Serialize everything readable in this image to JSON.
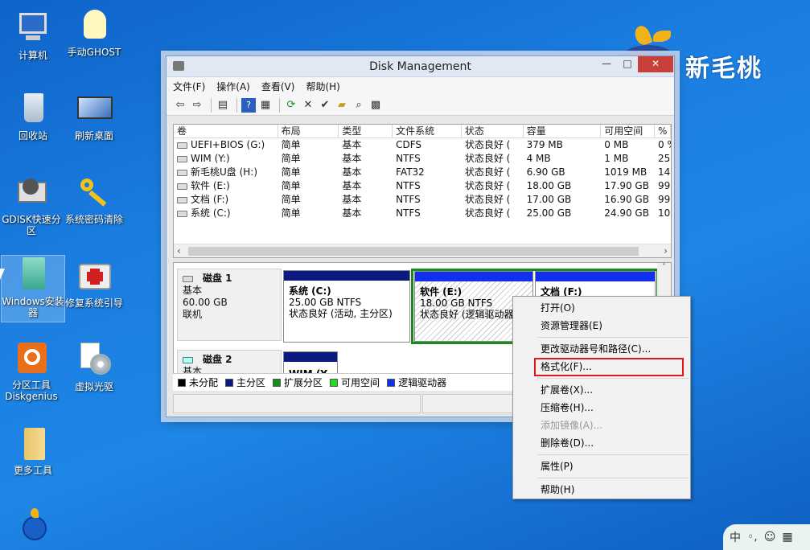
{
  "desktop": {
    "icons": [
      {
        "label": "计算机"
      },
      {
        "label": "手动GHOST"
      },
      {
        "label": "回收站"
      },
      {
        "label": "刷新桌面"
      },
      {
        "label": "GDISK快速分区"
      },
      {
        "label": "系统密码清除"
      },
      {
        "label": "Windows安装器"
      },
      {
        "label": "修复系统引导"
      },
      {
        "label": "分区工具Diskgenius"
      },
      {
        "label": "虚拟光驱"
      },
      {
        "label": "更多工具"
      }
    ],
    "brand": "新毛桃"
  },
  "window": {
    "title": "Disk Management",
    "menu": [
      "文件(F)",
      "操作(A)",
      "查看(V)",
      "帮助(H)"
    ],
    "columns": [
      "卷",
      "布局",
      "类型",
      "文件系统",
      "状态",
      "容量",
      "可用空间",
      "%"
    ],
    "volumes": [
      [
        "UEFI+BIOS (G:)",
        "简单",
        "基本",
        "CDFS",
        "状态良好 (",
        "379 MB",
        "0 MB",
        "0 %"
      ],
      [
        "WIM (Y:)",
        "简单",
        "基本",
        "NTFS",
        "状态良好 (",
        "4 MB",
        "1 MB",
        "25"
      ],
      [
        "新毛桃U盘 (H:)",
        "简单",
        "基本",
        "FAT32",
        "状态良好 (",
        "6.90 GB",
        "1019 MB",
        "14"
      ],
      [
        "软件 (E:)",
        "简单",
        "基本",
        "NTFS",
        "状态良好 (",
        "18.00 GB",
        "17.90 GB",
        "99"
      ],
      [
        "文档 (F:)",
        "简单",
        "基本",
        "NTFS",
        "状态良好 (",
        "17.00 GB",
        "16.90 GB",
        "99"
      ],
      [
        "系统 (C:)",
        "简单",
        "基本",
        "NTFS",
        "状态良好 (",
        "25.00 GB",
        "24.90 GB",
        "10"
      ]
    ],
    "disk1": {
      "name": "磁盘 1",
      "type": "基本",
      "size": "60.00 GB",
      "state": "联机",
      "partitions": [
        {
          "title": "系统  (C:)",
          "detail": "25.00 GB NTFS",
          "status": "状态良好 (活动, 主分区)"
        },
        {
          "title": "软件  (E:)",
          "detail": "18.00 GB NTFS",
          "status": "状态良好 (逻辑驱动器"
        },
        {
          "title": "文档  (F:)",
          "detail": "",
          "status": ""
        }
      ]
    },
    "disk2": {
      "name": "磁盘 2",
      "type": "基本",
      "partition_title": "WIM  (Y"
    },
    "legend": [
      {
        "label": "未分配",
        "color": "#000000"
      },
      {
        "label": "主分区",
        "color": "#0a1a80"
      },
      {
        "label": "扩展分区",
        "color": "#1a8a1a"
      },
      {
        "label": "可用空间",
        "color": "#22dd22"
      },
      {
        "label": "逻辑驱动器",
        "color": "#1030ee"
      }
    ]
  },
  "context_menu": {
    "items": [
      {
        "label": "打开(O)",
        "disabled": false
      },
      {
        "label": "资源管理器(E)",
        "disabled": false
      },
      {
        "sep": true
      },
      {
        "label": "更改驱动器号和路径(C)...",
        "disabled": false
      },
      {
        "label": "格式化(F)...",
        "disabled": false
      },
      {
        "sep": true
      },
      {
        "label": "扩展卷(X)...",
        "disabled": false
      },
      {
        "label": "压缩卷(H)...",
        "disabled": false
      },
      {
        "label": "添加镜像(A)...",
        "disabled": true
      },
      {
        "label": "删除卷(D)...",
        "disabled": false
      },
      {
        "sep": true
      },
      {
        "label": "属性(P)",
        "disabled": false
      },
      {
        "sep": true
      },
      {
        "label": "帮助(H)",
        "disabled": false
      }
    ]
  },
  "tray": {
    "ime": "中"
  }
}
